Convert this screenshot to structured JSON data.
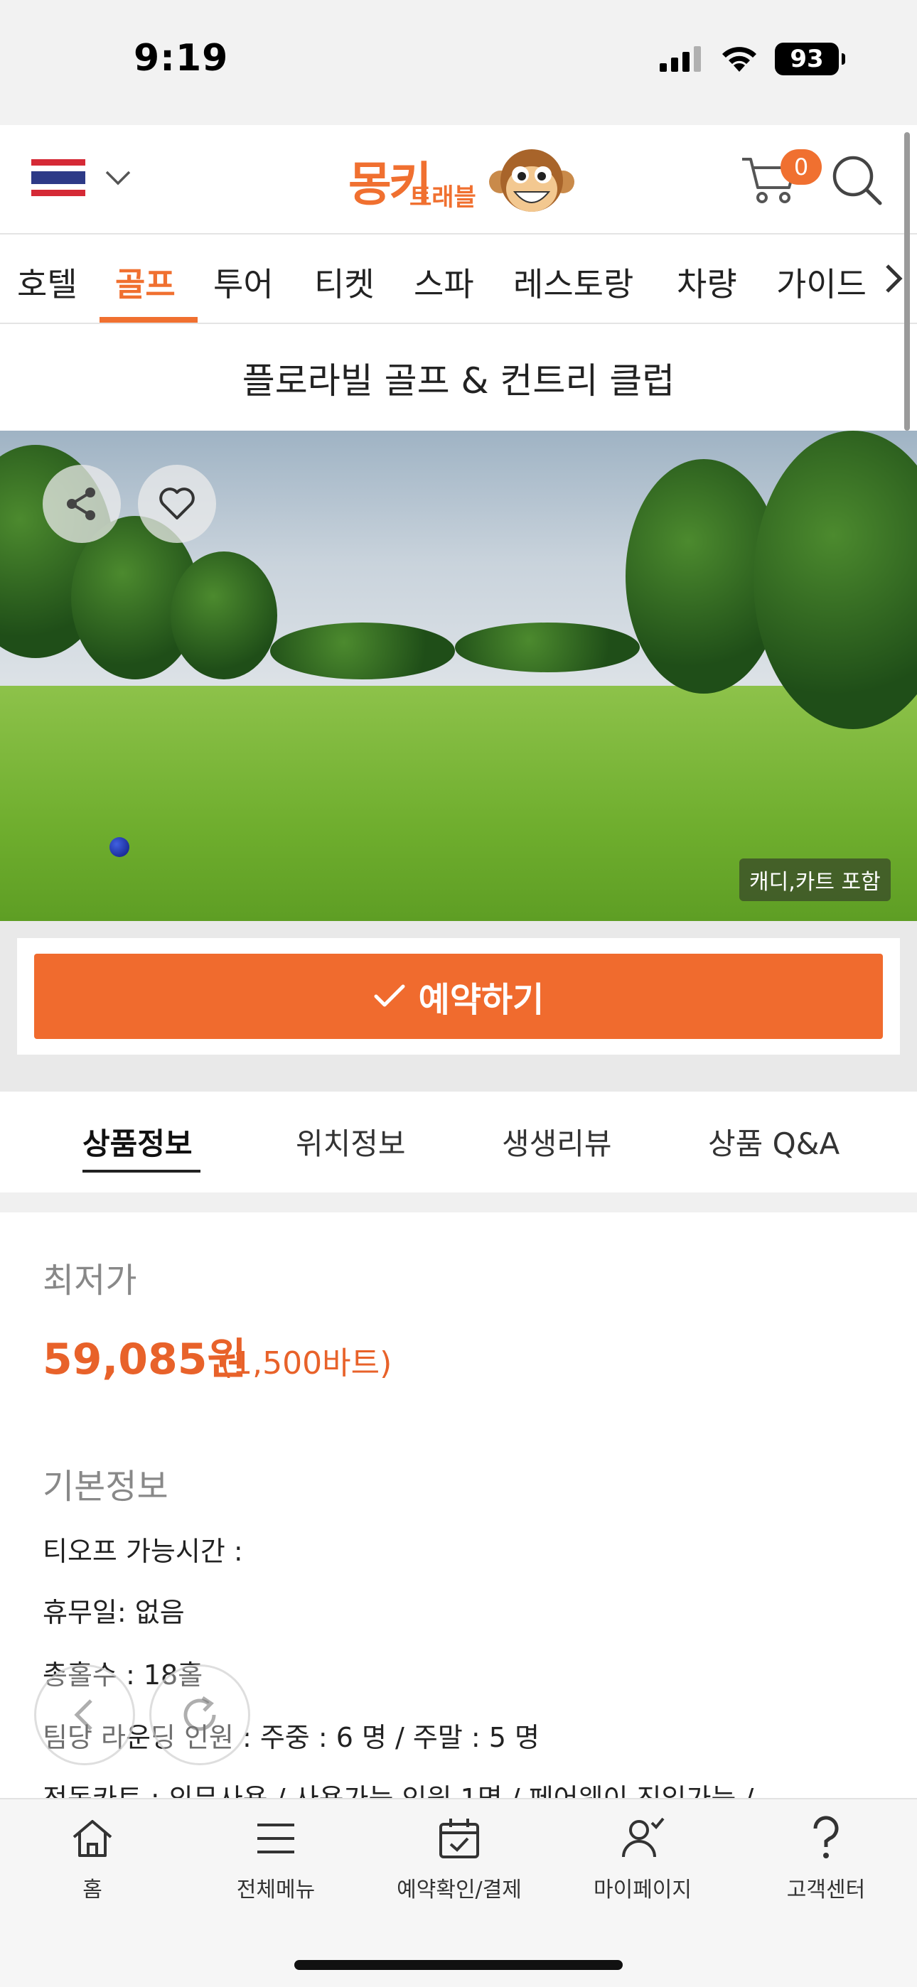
{
  "status_bar": {
    "time": "9:19",
    "battery": "93"
  },
  "header": {
    "country_flag": "thailand-flag",
    "logo": {
      "main": "몽키",
      "sub": "트래블"
    },
    "cart_count": "0"
  },
  "categories": {
    "items": [
      "호텔",
      "골프",
      "투어",
      "티켓",
      "스파",
      "레스토랑",
      "차량",
      "가이드"
    ],
    "active": "골프"
  },
  "page_title": "플로라빌 골프 & 컨트리 클럽",
  "hero": {
    "badge": "캐디,카트 포함"
  },
  "reserve": {
    "label": "예약하기"
  },
  "info_tabs": {
    "items": [
      "상품정보",
      "위치정보",
      "생생리뷰",
      "상품 Q&A"
    ],
    "active": "상품정보"
  },
  "price": {
    "heading": "최저가",
    "krw": "59,085원",
    "thb": "(1,500바트)"
  },
  "basic_info": {
    "heading": "기본정보",
    "lines": [
      "티오프 가능시간 :",
      "휴무일: 없음",
      "총홀수 : 18홀",
      "팀당 라운딩 인원 : 주중 : 6 명 / 주말 : 5 명",
      "전동카트 : 의무사용 / 사용가능 인원 1명 / 페어웨이 진입가능 /"
    ]
  },
  "bottom_nav": {
    "items": [
      "홈",
      "전체메뉴",
      "예약확인/결제",
      "마이페이지",
      "고객센터"
    ]
  },
  "colors": {
    "accent": "#f07030",
    "price": "#e8622a",
    "reserve_button": "#f06b2e"
  }
}
